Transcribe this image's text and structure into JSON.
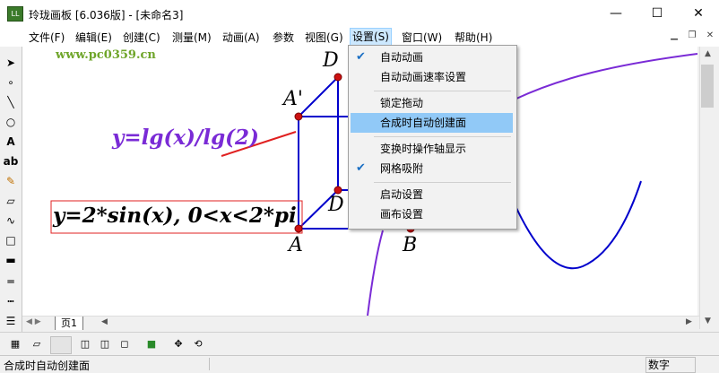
{
  "window": {
    "title": "玲珑画板 [6.036版] - [未命名3]",
    "app_icon_text": "LL",
    "minimize": "—",
    "maximize": "☐",
    "close": "✕"
  },
  "watermark": "www.pc0359.cn",
  "menu": [
    "文件(F)",
    "编辑(E)",
    "创建(C)",
    "测量(M)",
    "动画(A)",
    "参数",
    "视图(G)",
    "设置(S)",
    "窗口(W)",
    "帮助(H)"
  ],
  "active_menu_index": 7,
  "dropdown": {
    "items": [
      {
        "label": "自动动画",
        "checked": true
      },
      {
        "label": "自动动画速率设置",
        "checked": false
      },
      {
        "label": "锁定拖动",
        "checked": false
      },
      {
        "label": "合成时自动创建面",
        "checked": false,
        "highlighted": true
      },
      {
        "label": "变换时操作轴显示",
        "checked": false
      },
      {
        "label": "网格吸附",
        "checked": true
      },
      {
        "label": "启动设置",
        "checked": false
      },
      {
        "label": "画布设置",
        "checked": false
      }
    ]
  },
  "canvas_labels": {
    "D_top": "D",
    "A_prime": "A'",
    "D_bottom": "D",
    "A": "A",
    "B": "B",
    "formula_log": "y=lg(x)/lg(2)",
    "formula_sin": "y=2*sin(x), 0<x<2*pi"
  },
  "tab": {
    "label": "页1"
  },
  "status": {
    "message": "合成时自动创建面",
    "mode": "数字"
  },
  "colors": {
    "accent_blue": "#0000cc",
    "purple": "#7a2bd6",
    "point_red": "#cc1111",
    "highlight": "#91c9f7"
  }
}
